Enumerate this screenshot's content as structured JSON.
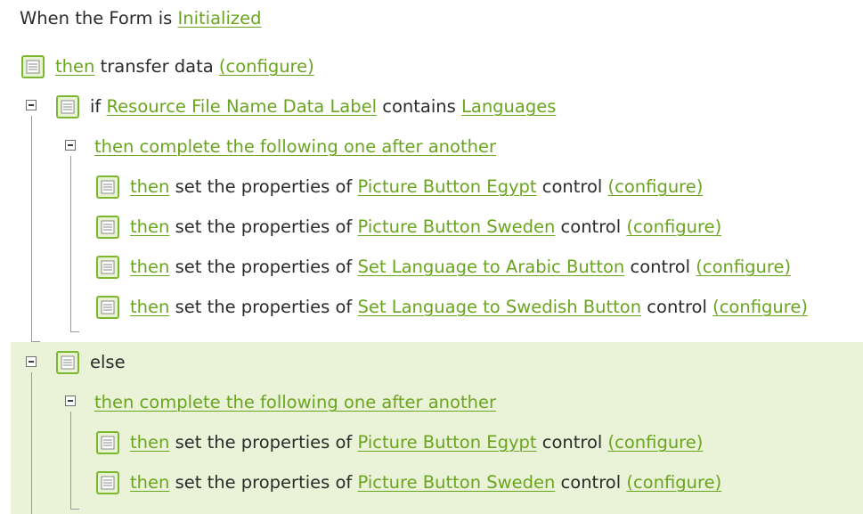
{
  "colors": {
    "link": "#6aa51f",
    "else_background": "#eaf2d7",
    "icon_green": "#7cb82f"
  },
  "icons": {
    "action": "action-list-icon",
    "toggle": "collapse-minus-icon"
  },
  "header": {
    "prefix": "When the Form is",
    "event": "Initialized"
  },
  "rule1": {
    "then": "then",
    "text": "transfer data",
    "configure": "(configure)"
  },
  "if_block": {
    "if": "if",
    "field": "Resource File Name Data Label",
    "op": "contains",
    "value": "Languages",
    "sequence": "then complete the following one after another",
    "actions": [
      {
        "then": "then",
        "prefix": "set the properties of",
        "target": "Picture Button Egypt",
        "suffix": "control",
        "configure": "(configure)"
      },
      {
        "then": "then",
        "prefix": "set the properties of",
        "target": "Picture Button Sweden",
        "suffix": "control",
        "configure": "(configure)"
      },
      {
        "then": "then",
        "prefix": "set the properties of",
        "target": "Set Language to Arabic Button",
        "suffix": "control",
        "configure": "(configure)"
      },
      {
        "then": "then",
        "prefix": "set the properties of",
        "target": "Set Language to Swedish Button",
        "suffix": "control",
        "configure": "(configure)"
      }
    ]
  },
  "else_block": {
    "else": "else",
    "sequence": "then complete the following one after another",
    "actions": [
      {
        "then": "then",
        "prefix": "set the properties of",
        "target": "Picture Button Egypt",
        "suffix": "control",
        "configure": "(configure)"
      },
      {
        "then": "then",
        "prefix": "set the properties of",
        "target": "Picture Button Sweden",
        "suffix": "control",
        "configure": "(configure)"
      }
    ]
  }
}
